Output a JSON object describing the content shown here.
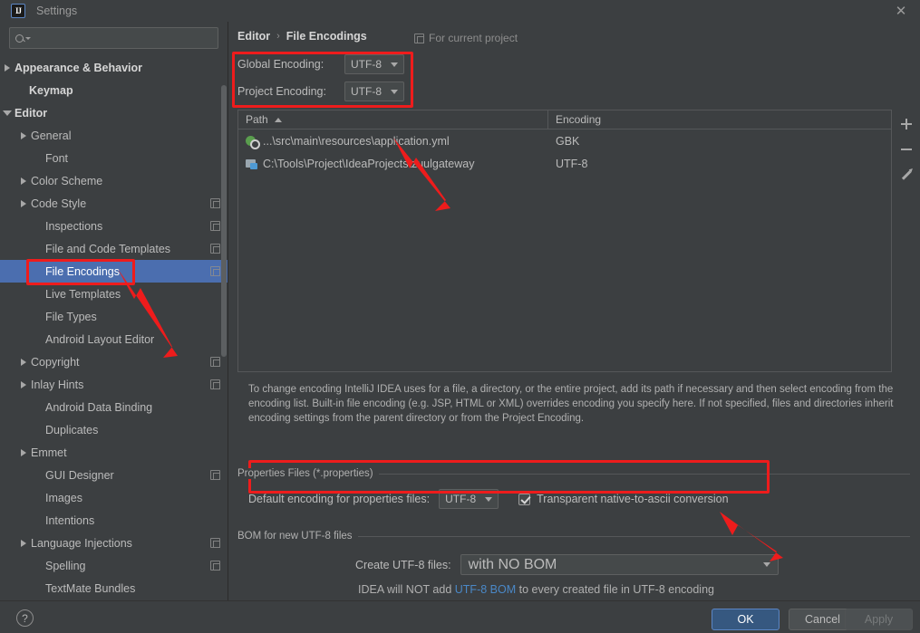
{
  "window": {
    "title": "Settings",
    "logo_text": "IJ",
    "close_label": "✕"
  },
  "search": {
    "value": "",
    "placeholder": ""
  },
  "sidebar": {
    "items": [
      {
        "label": "Appearance & Behavior",
        "arrow": "collapsed",
        "bold": true,
        "indent": 14,
        "badge": false,
        "selected": false
      },
      {
        "label": "Keymap",
        "arrow": "none",
        "bold": true,
        "indent": 30,
        "badge": false,
        "selected": false
      },
      {
        "label": "Editor",
        "arrow": "expanded",
        "bold": true,
        "indent": 14,
        "badge": false,
        "selected": false
      },
      {
        "label": "General",
        "arrow": "collapsed",
        "bold": false,
        "indent": 32,
        "badge": false,
        "selected": false
      },
      {
        "label": "Font",
        "arrow": "none",
        "bold": false,
        "indent": 48,
        "badge": false,
        "selected": false
      },
      {
        "label": "Color Scheme",
        "arrow": "collapsed",
        "bold": false,
        "indent": 32,
        "badge": false,
        "selected": false
      },
      {
        "label": "Code Style",
        "arrow": "collapsed",
        "bold": false,
        "indent": 32,
        "badge": true,
        "selected": false
      },
      {
        "label": "Inspections",
        "arrow": "none",
        "bold": false,
        "indent": 48,
        "badge": true,
        "selected": false
      },
      {
        "label": "File and Code Templates",
        "arrow": "none",
        "bold": false,
        "indent": 48,
        "badge": true,
        "selected": false
      },
      {
        "label": "File Encodings",
        "arrow": "none",
        "bold": false,
        "indent": 48,
        "badge": true,
        "selected": true
      },
      {
        "label": "Live Templates",
        "arrow": "none",
        "bold": false,
        "indent": 48,
        "badge": false,
        "selected": false
      },
      {
        "label": "File Types",
        "arrow": "none",
        "bold": false,
        "indent": 48,
        "badge": false,
        "selected": false
      },
      {
        "label": "Android Layout Editor",
        "arrow": "none",
        "bold": false,
        "indent": 48,
        "badge": false,
        "selected": false
      },
      {
        "label": "Copyright",
        "arrow": "collapsed",
        "bold": false,
        "indent": 32,
        "badge": true,
        "selected": false
      },
      {
        "label": "Inlay Hints",
        "arrow": "collapsed",
        "bold": false,
        "indent": 32,
        "badge": true,
        "selected": false
      },
      {
        "label": "Android Data Binding",
        "arrow": "none",
        "bold": false,
        "indent": 48,
        "badge": false,
        "selected": false
      },
      {
        "label": "Duplicates",
        "arrow": "none",
        "bold": false,
        "indent": 48,
        "badge": false,
        "selected": false
      },
      {
        "label": "Emmet",
        "arrow": "collapsed",
        "bold": false,
        "indent": 32,
        "badge": false,
        "selected": false
      },
      {
        "label": "GUI Designer",
        "arrow": "none",
        "bold": false,
        "indent": 48,
        "badge": true,
        "selected": false
      },
      {
        "label": "Images",
        "arrow": "none",
        "bold": false,
        "indent": 48,
        "badge": false,
        "selected": false
      },
      {
        "label": "Intentions",
        "arrow": "none",
        "bold": false,
        "indent": 48,
        "badge": false,
        "selected": false
      },
      {
        "label": "Language Injections",
        "arrow": "collapsed",
        "bold": false,
        "indent": 32,
        "badge": true,
        "selected": false
      },
      {
        "label": "Spelling",
        "arrow": "none",
        "bold": false,
        "indent": 48,
        "badge": true,
        "selected": false
      },
      {
        "label": "TextMate Bundles",
        "arrow": "none",
        "bold": false,
        "indent": 48,
        "badge": false,
        "selected": false
      }
    ]
  },
  "main": {
    "breadcrumb": {
      "parent": "Editor",
      "separator": "›",
      "current": "File Encodings"
    },
    "for_current_project": "For current project",
    "global_encoding": {
      "label": "Global Encoding:",
      "value": "UTF-8"
    },
    "project_encoding": {
      "label": "Project Encoding:",
      "value": "UTF-8"
    },
    "table": {
      "columns": [
        "Path",
        "Encoding"
      ],
      "sort_column": "Path",
      "sort_direction": "asc",
      "rows": [
        {
          "path": "...\\src\\main\\resources\\application.yml",
          "encoding": "GBK",
          "icon": "yml-file-icon"
        },
        {
          "path": "C:\\Tools\\Project\\IdeaProjects\\zuulgateway",
          "encoding": "UTF-8",
          "icon": "module-folder-icon"
        }
      ]
    },
    "toolbar": {
      "add": "+",
      "remove": "−",
      "edit": "edit-pencil"
    },
    "description": "To change encoding IntelliJ IDEA uses for a file, a directory, or the entire project, add its path if necessary and then select encoding from the encoding list. Built-in file encoding (e.g. JSP, HTML or XML) overrides encoding you specify here. If not specified, files and directories inherit encoding settings from the parent directory or from the Project Encoding.",
    "properties_group": {
      "title": "Properties Files (*.properties)",
      "default_encoding_label": "Default encoding for properties files:",
      "default_encoding_value": "UTF-8",
      "transparent_label": "Transparent native-to-ascii conversion",
      "transparent_checked": true
    },
    "bom_group": {
      "title": "BOM for new UTF-8 files",
      "create_label": "Create UTF-8 files:",
      "create_value": "with NO BOM",
      "note_prefix": "IDEA will NOT add ",
      "note_link": "UTF-8 BOM",
      "note_suffix": " to every created file in UTF-8 encoding"
    }
  },
  "footer": {
    "help": "?",
    "ok": "OK",
    "cancel": "Cancel",
    "apply": "Apply"
  },
  "colors": {
    "panel_bg": "#3c3f41",
    "selection_blue": "#4b6eaf",
    "annotation_red": "#ee1c1c",
    "link_blue": "#4a88c7",
    "ok_button": "#365880"
  }
}
